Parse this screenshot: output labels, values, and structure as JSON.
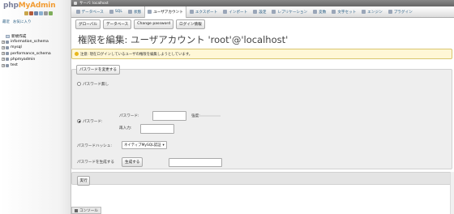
{
  "nav": {
    "logo_part1": "php",
    "logo_part2": "MyAdmin",
    "tabs": [
      "最近",
      "お気に入り"
    ],
    "new_label": "新規作成",
    "databases": [
      "information_schema",
      "mysql",
      "performance_schema",
      "phpmyadmin",
      "test"
    ]
  },
  "breadcrumb": {
    "server": "サーバ: localhost"
  },
  "tabs": [
    "データベース",
    "SQL",
    "状態",
    "ユーザアカウント",
    "エクスポート",
    "インポート",
    "設定",
    "レプリケーション",
    "変数",
    "文字セット",
    "エンジン",
    "プラグイン"
  ],
  "active_tab": "ユーザアカウント",
  "subtabs": [
    "グローバル",
    "データベース",
    "Change password",
    "ログイン情報"
  ],
  "page_title": "権限を編集: ユーザアカウント 'root'@'localhost'",
  "notice": "注意: 現在ログインしているユーザの権限を編集しようとしています。",
  "form": {
    "legend": "パスワードを変更する",
    "no_password": "パスワード無し",
    "password": "パスワード:",
    "field_password": "パスワード:",
    "strength_label": "強度:",
    "reenter": "再入力:",
    "hashing_label": "パスワードハッシュ:",
    "hashing_value": "ネイティブMySQL認証",
    "generate_label": "パスワードを生成する",
    "generate_button": "生成する",
    "submit": "実行"
  },
  "console_label": "コンソール",
  "colors": {
    "logo_php": "#7a7f9a",
    "logo_myadmin": "#f29c33",
    "notice_bg": "#fff7d6"
  }
}
